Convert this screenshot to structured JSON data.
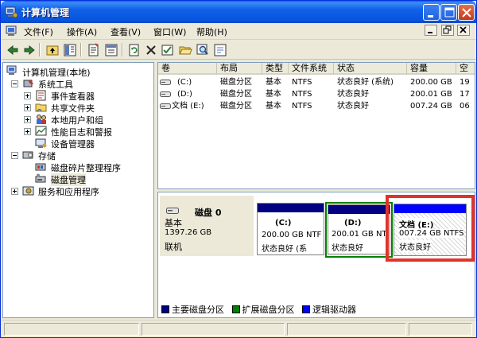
{
  "window": {
    "title": "计算机管理"
  },
  "menu": [
    {
      "label": "文件(F)"
    },
    {
      "label": "操作(A)"
    },
    {
      "label": "查看(V)"
    },
    {
      "label": "窗口(W)"
    },
    {
      "label": "帮助(H)"
    }
  ],
  "tree": {
    "root": "计算机管理(本地)",
    "system_tools": "系统工具",
    "event_viewer": "事件查看器",
    "shared_folders": "共享文件夹",
    "local_users": "本地用户和组",
    "perf_logs": "性能日志和警报",
    "device_manager": "设备管理器",
    "storage": "存储",
    "defrag": "磁盘碎片整理程序",
    "disk_mgmt": "磁盘管理",
    "services": "服务和应用程序"
  },
  "list": {
    "columns": [
      "卷",
      "布局",
      "类型",
      "文件系统",
      "状态",
      "容量",
      "空"
    ],
    "rows": [
      [
        "(C:)",
        "磁盘分区",
        "基本",
        "NTFS",
        "状态良好 (系统)",
        "200.00 GB",
        "19"
      ],
      [
        "(D:)",
        "磁盘分区",
        "基本",
        "NTFS",
        "状态良好",
        "200.01 GB",
        "17"
      ],
      [
        "文档 (E:)",
        "磁盘分区",
        "基本",
        "NTFS",
        "状态良好",
        "007.24 GB",
        "06"
      ]
    ]
  },
  "disk": {
    "name": "磁盘 0",
    "type": "基本",
    "size": "1397.26 GB",
    "state": "联机",
    "partitions": [
      {
        "label": "(C:)",
        "size": "200.00 GB NTF",
        "status": "状态良好 (系",
        "bar_color": "#000080"
      },
      {
        "label": "(D:)",
        "size": "200.01 GB NT",
        "status": "状态良好",
        "bar_color": "#000080"
      },
      {
        "label": "文档 (E:)",
        "size": "007.24 GB NTFS",
        "status": "状态良好",
        "bar_color": "#0000FF"
      }
    ]
  },
  "legend": [
    {
      "label": "主要磁盘分区",
      "color": "#000080"
    },
    {
      "label": "扩展磁盘分区",
      "color": "#008000"
    },
    {
      "label": "逻辑驱动器",
      "color": "#0000FF"
    }
  ],
  "colors": {
    "title_bar": "#0854DD",
    "extended_border": "#008000",
    "highlight": "#E0332A"
  }
}
